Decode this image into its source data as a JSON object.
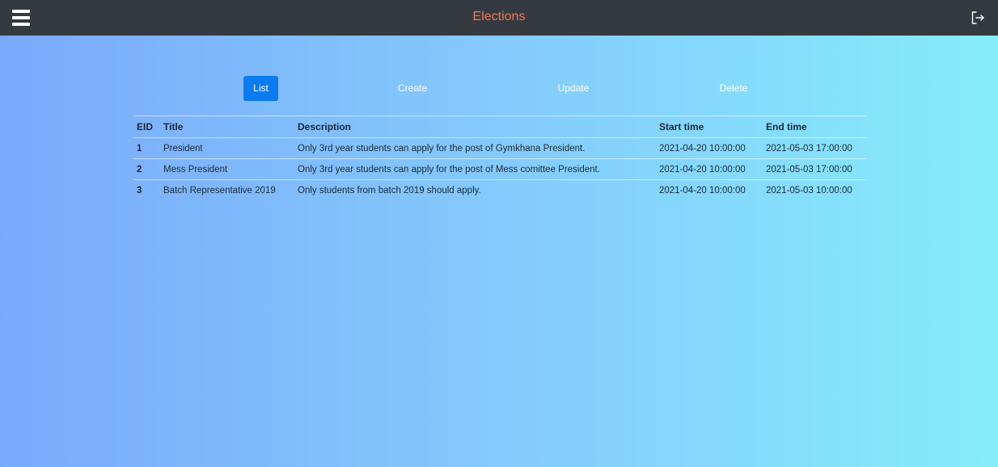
{
  "header": {
    "title": "Elections",
    "menu_icon": "hamburger-menu-icon",
    "logout_icon": "logout-icon"
  },
  "tabs": [
    {
      "label": "List",
      "active": true
    },
    {
      "label": "Create",
      "active": false
    },
    {
      "label": "Update",
      "active": false
    },
    {
      "label": "Delete",
      "active": false
    }
  ],
  "table": {
    "columns": [
      "EID",
      "Title",
      "Description",
      "Start time",
      "End time"
    ],
    "rows": [
      {
        "eid": "1",
        "title": "President",
        "description": "Only 3rd year students can apply for the post of Gymkhana President.",
        "start": "2021-04-20 10:00:00",
        "end": "2021-05-03 17:00:00"
      },
      {
        "eid": "2",
        "title": "Mess President",
        "description": "Only 3rd year students can apply for the post of Mess comittee President.",
        "start": "2021-04-20 10:00:00",
        "end": "2021-05-03 17:00:00"
      },
      {
        "eid": "3",
        "title": "Batch Representative 2019",
        "description": "Only students from batch 2019 should apply.",
        "start": "2021-04-20 10:00:00",
        "end": "2021-05-03 10:00:00"
      }
    ]
  },
  "colors": {
    "header_bg": "#343a40",
    "title": "#f0785a",
    "active_tab": "#0a7cf0"
  }
}
